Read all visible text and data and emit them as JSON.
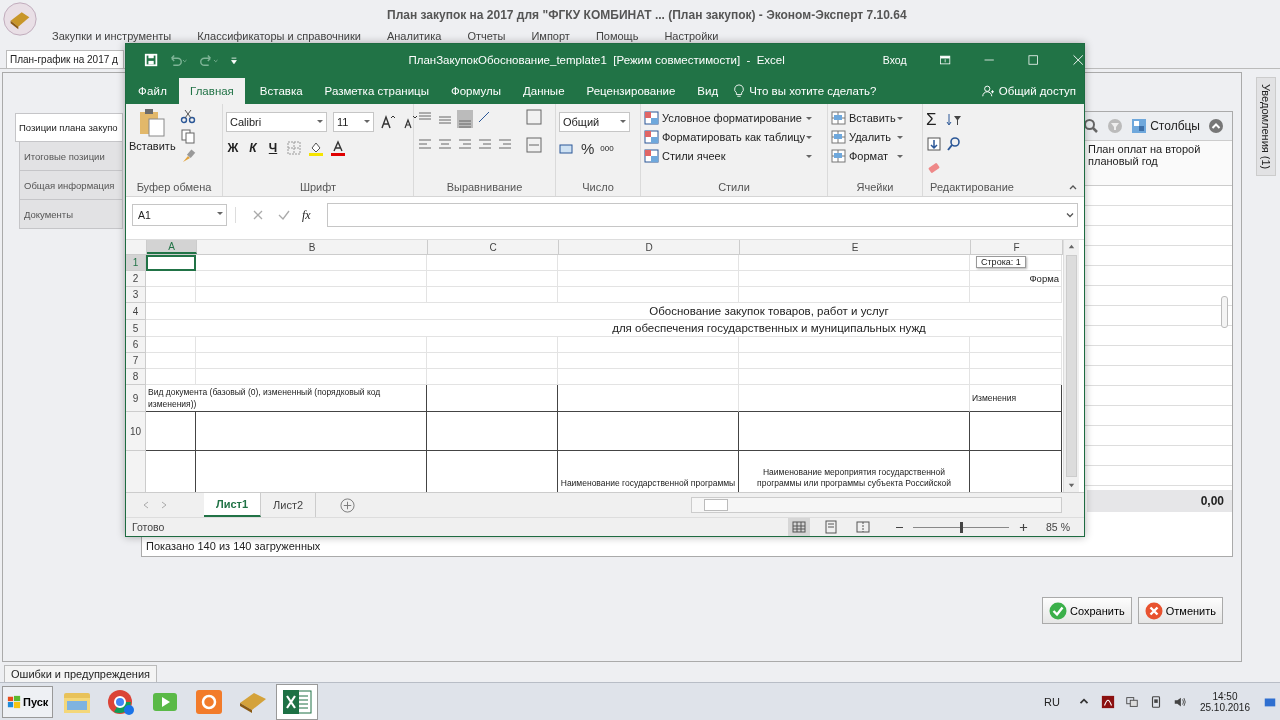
{
  "app": {
    "title": "План закупок на 2017 для \"ФГКУ КОМБИНАТ ... (План закупок) - Эконом-Эксперт 7.10.64",
    "menu": [
      "Закупки и инструменты",
      "Классификаторы и справочники",
      "Аналитика",
      "Отчеты",
      "Импорт",
      "Помощь",
      "Настройки"
    ],
    "doc_tab": "План-график на 2017 д",
    "side_tabs": [
      {
        "label": "Позиции плана закупо",
        "selected": true
      },
      {
        "label": "Итоговые позиции",
        "selected": false
      },
      {
        "label": "Общая информация",
        "selected": false
      },
      {
        "label": "Документы",
        "selected": false
      }
    ],
    "grid": {
      "columns_button": "Столбцы",
      "column_header": "План оплат на второй плановый год",
      "total": "0,00",
      "status": "Показано 140 из 140 загруженных"
    },
    "vertical_tab": "Уведомления (1)",
    "buttons": [
      {
        "kind": "save",
        "label": "Сохранить"
      },
      {
        "kind": "cancel",
        "label": "Отменить"
      }
    ],
    "bottom_tab": "Ошибки и предупреждения"
  },
  "excel": {
    "title": "ПланЗакупокОбоснование_template1  [Режим совместимости]  -  Excel",
    "signin": "Вход",
    "tabs": [
      {
        "label": "Файл",
        "kind": "file",
        "selected": false
      },
      {
        "label": "Главная",
        "kind": "tab",
        "selected": true
      },
      {
        "label": "Вставка",
        "kind": "tab",
        "selected": false
      },
      {
        "label": "Разметка страницы",
        "kind": "tab",
        "selected": false
      },
      {
        "label": "Формулы",
        "kind": "tab",
        "selected": false
      },
      {
        "label": "Данные",
        "kind": "tab",
        "selected": false
      },
      {
        "label": "Рецензирование",
        "kind": "tab",
        "selected": false
      },
      {
        "label": "Вид",
        "kind": "tab",
        "selected": false
      }
    ],
    "tell_me": "Что вы хотите сделать?",
    "share": "Общий доступ",
    "groups": [
      {
        "kind": "clipboard",
        "label": "Буфер обмена",
        "paste": "Вставить"
      },
      {
        "kind": "font",
        "label": "Шрифт",
        "font": "Calibri",
        "size": "11",
        "bold": "Ж",
        "italic": "К",
        "underline": "Ч"
      },
      {
        "kind": "alignment",
        "label": "Выравнивание"
      },
      {
        "kind": "number",
        "label": "Число",
        "format": "Общий",
        "percent": "%",
        "thousands": "000"
      },
      {
        "kind": "styles",
        "label": "Стили",
        "items": [
          "Условное форматирование",
          "Форматировать как таблицу",
          "Стили ячеек"
        ]
      },
      {
        "kind": "cells",
        "label": "Ячейки",
        "items": [
          "Вставить",
          "Удалить",
          "Формат"
        ]
      },
      {
        "kind": "editing",
        "label": "Редактирование",
        "sum": "Σ"
      }
    ],
    "name_box": "A1",
    "fx": "fx",
    "columns": [
      {
        "label": "A",
        "selected": true
      },
      {
        "label": "B",
        "selected": false
      },
      {
        "label": "C",
        "selected": false
      },
      {
        "label": "D",
        "selected": false
      },
      {
        "label": "E",
        "selected": false
      },
      {
        "label": "F",
        "selected": false
      }
    ],
    "rows": [
      {
        "number": "1",
        "kind": "plain",
        "selected": true
      },
      {
        "number": "2",
        "kind": "plain",
        "selected": false,
        "f": "Форма"
      },
      {
        "number": "3",
        "kind": "plain",
        "selected": false
      },
      {
        "number": "4",
        "kind": "title",
        "selected": false,
        "merged": "Обоснование закупок товаров, работ и услуг"
      },
      {
        "number": "5",
        "kind": "title",
        "selected": false,
        "merged": "для обеспечения государственных и муниципальных нужд"
      },
      {
        "number": "6",
        "kind": "plain",
        "selected": false
      },
      {
        "number": "7",
        "kind": "plain",
        "selected": false
      },
      {
        "number": "8",
        "kind": "plain",
        "selected": false
      },
      {
        "number": "9",
        "kind": "boxed",
        "selected": false,
        "ab": "Вид документа (базовый (0), измененный (порядковый код изменения))",
        "f": "Изменения"
      },
      {
        "number": "10",
        "kind": "tall",
        "selected": false
      },
      {
        "kind": "header",
        "selected": false,
        "d": "Наименование государственной программы",
        "e": "Наименование мероприятия государственной программы или программы субъекта Российской"
      }
    ],
    "tooltip": "Строка: 1",
    "sheets": [
      {
        "label": "Лист1",
        "selected": true
      },
      {
        "label": "Лист2",
        "selected": false
      }
    ],
    "status": "Готово",
    "zoom": {
      "level": 0.5,
      "reading": "85 %"
    }
  },
  "taskbar": {
    "start": "Пуск",
    "lang": "RU",
    "time": "14:50",
    "date": "25.10.2016"
  }
}
